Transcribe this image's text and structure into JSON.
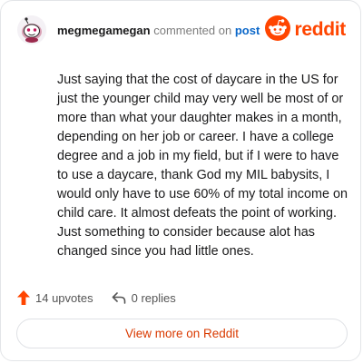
{
  "header": {
    "username": "megmegamegan",
    "action_text": "commented on",
    "target_link": "post"
  },
  "logo": {
    "wordmark": "reddit",
    "icon": "reddit-snoo-icon"
  },
  "avatar": {
    "icon": "user-avatar-icon"
  },
  "comment": {
    "body": "Just saying that the cost of daycare in the US for just the younger child may very well be most of or more than what your daughter makes in a month, depending on her job or career. I have a college degree and a job in my field, but if I were to have to use a daycare, thank God my MIL babysits, I would only have to use 60% of my total income on child care. It almost defeats the point of working. Just something to consider because alot has changed since you had little ones."
  },
  "stats": {
    "upvotes": "14 upvotes",
    "replies": "0 replies",
    "upvote_icon": "upvote-arrow-icon",
    "reply_icon": "reply-arrow-icon"
  },
  "cta": {
    "label": "View more on Reddit"
  },
  "colors": {
    "brand_orange": "#ff4500",
    "link_blue": "#0b67c9",
    "cta_text": "#d93a00"
  }
}
